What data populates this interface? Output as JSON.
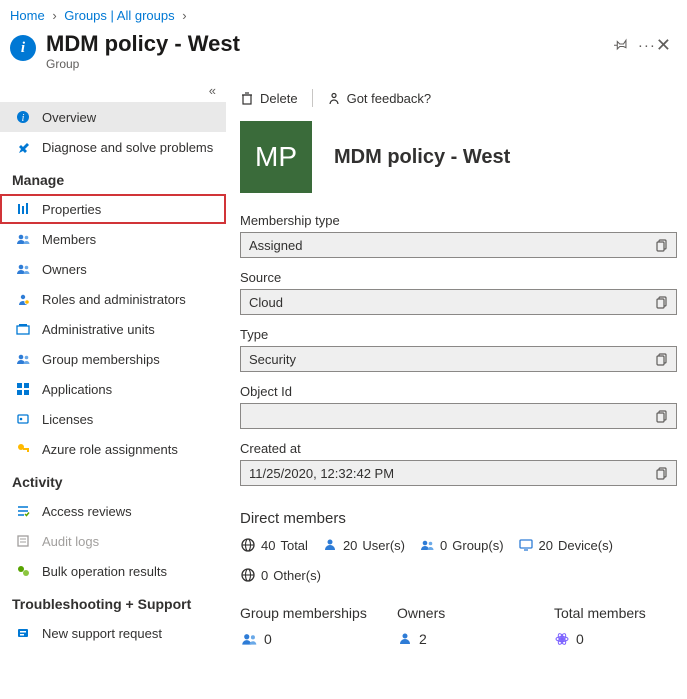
{
  "breadcrumb": {
    "home": "Home",
    "groups": "Groups | All groups"
  },
  "header": {
    "title": "MDM policy - West",
    "subtitle": "Group"
  },
  "sidebar": {
    "overview": "Overview",
    "diagnose": "Diagnose and solve problems",
    "section_manage": "Manage",
    "properties": "Properties",
    "members": "Members",
    "owners": "Owners",
    "roles": "Roles and administrators",
    "admin_units": "Administrative units",
    "group_memberships": "Group memberships",
    "applications": "Applications",
    "licenses": "Licenses",
    "azure_roles": "Azure role assignments",
    "section_activity": "Activity",
    "access_reviews": "Access reviews",
    "audit_logs": "Audit logs",
    "bulk_ops": "Bulk operation results",
    "section_trouble": "Troubleshooting + Support",
    "support": "New support request"
  },
  "toolbar": {
    "delete": "Delete",
    "feedback": "Got feedback?"
  },
  "group": {
    "avatar_initials": "MP",
    "name": "MDM policy - West"
  },
  "fields": {
    "membership_type_label": "Membership type",
    "membership_type_value": "Assigned",
    "source_label": "Source",
    "source_value": "Cloud",
    "type_label": "Type",
    "type_value": "Security",
    "object_id_label": "Object Id",
    "object_id_value": "",
    "created_label": "Created at",
    "created_value": "11/25/2020, 12:32:42 PM"
  },
  "direct_members": {
    "title": "Direct members",
    "total_n": "40",
    "total_lbl": "Total",
    "users_n": "20",
    "users_lbl": "User(s)",
    "groups_n": "0",
    "groups_lbl": "Group(s)",
    "devices_n": "20",
    "devices_lbl": "Device(s)",
    "others_n": "0",
    "others_lbl": "Other(s)"
  },
  "bottom": {
    "memberships_label": "Group memberships",
    "memberships_value": "0",
    "owners_label": "Owners",
    "owners_value": "2",
    "total_label": "Total members",
    "total_value": "0"
  }
}
